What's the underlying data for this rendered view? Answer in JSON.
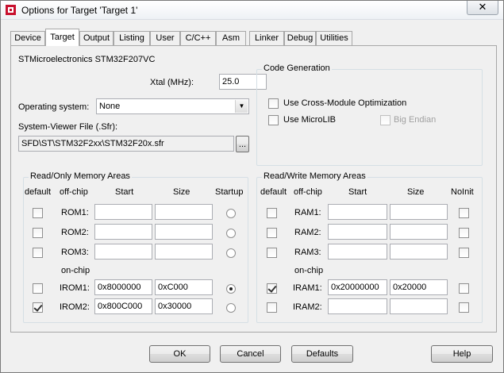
{
  "window": {
    "title": "Options for Target 'Target 1'",
    "close_glyph": "✕"
  },
  "tabs": [
    {
      "label": "Device"
    },
    {
      "label": "Target"
    },
    {
      "label": "Output"
    },
    {
      "label": "Listing"
    },
    {
      "label": "User"
    },
    {
      "label": "C/C++"
    },
    {
      "label": "Asm"
    },
    {
      "label": "Linker"
    },
    {
      "label": "Debug"
    },
    {
      "label": "Utilities"
    }
  ],
  "active_tab": "Target",
  "device": {
    "name": "STMicroelectronics STM32F207VC",
    "xtal_label": "Xtal (MHz):",
    "xtal_value": "25.0",
    "os_label": "Operating system:",
    "os_value": "None",
    "sfr_label": "System-Viewer File (.Sfr):",
    "sfr_value": "SFD\\ST\\STM32F2xx\\STM32F20x.sfr",
    "browse_label": "..."
  },
  "code_generation": {
    "title": "Code Generation",
    "cross_module": {
      "label": "Use Cross-Module Optimization",
      "checked": false
    },
    "microlib": {
      "label": "Use MicroLIB",
      "checked": false
    },
    "big_endian": {
      "label": "Big Endian",
      "checked": false,
      "enabled": false
    }
  },
  "rom": {
    "title": "Read/Only Memory Areas",
    "headers": {
      "default": "default",
      "offchip": "off-chip",
      "start": "Start",
      "size": "Size",
      "startup": "Startup"
    },
    "onchip_label": "on-chip",
    "rows": [
      {
        "label": "ROM1:",
        "default": false,
        "start": "",
        "size": "",
        "startup": false
      },
      {
        "label": "ROM2:",
        "default": false,
        "start": "",
        "size": "",
        "startup": false
      },
      {
        "label": "ROM3:",
        "default": false,
        "start": "",
        "size": "",
        "startup": false
      },
      {
        "label": "IROM1:",
        "default": false,
        "start": "0x8000000",
        "size": "0xC000",
        "startup": true
      },
      {
        "label": "IROM2:",
        "default": true,
        "start": "0x800C000",
        "size": "0x30000",
        "startup": false
      }
    ]
  },
  "ram": {
    "title": "Read/Write Memory Areas",
    "headers": {
      "default": "default",
      "offchip": "off-chip",
      "start": "Start",
      "size": "Size",
      "noinit": "NoInit"
    },
    "onchip_label": "on-chip",
    "rows": [
      {
        "label": "RAM1:",
        "default": false,
        "start": "",
        "size": "",
        "noinit": false
      },
      {
        "label": "RAM2:",
        "default": false,
        "start": "",
        "size": "",
        "noinit": false
      },
      {
        "label": "RAM3:",
        "default": false,
        "start": "",
        "size": "",
        "noinit": false
      },
      {
        "label": "IRAM1:",
        "default": true,
        "start": "0x20000000",
        "size": "0x20000",
        "noinit": false
      },
      {
        "label": "IRAM2:",
        "default": false,
        "start": "",
        "size": "",
        "noinit": false
      }
    ]
  },
  "buttons": {
    "ok": "OK",
    "cancel": "Cancel",
    "defaults": "Defaults",
    "help": "Help"
  }
}
